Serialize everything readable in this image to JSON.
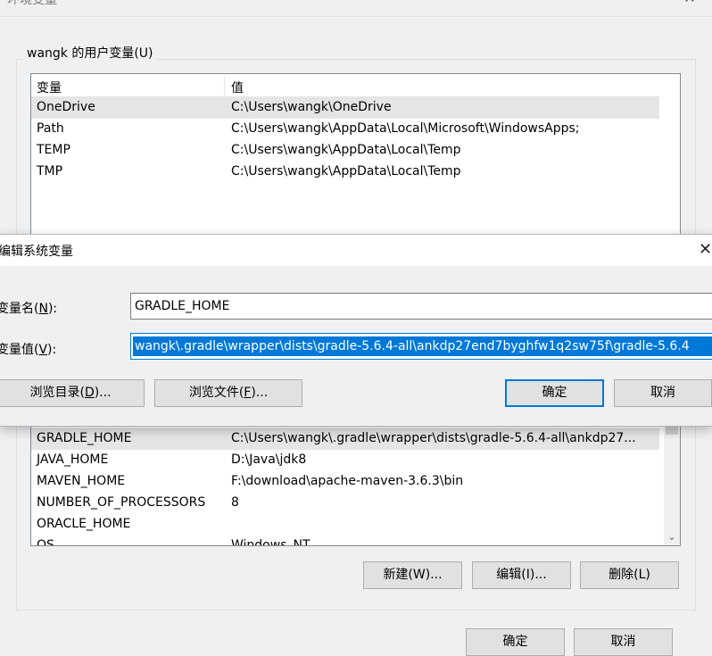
{
  "outer": {
    "title": "环境变量",
    "close_glyph": "✕",
    "user_group_label": "wangk 的用户变量(U)",
    "col_variable": "变量",
    "col_value": "值",
    "user_vars": [
      {
        "name": "OneDrive",
        "value": "C:\\Users\\wangk\\OneDrive"
      },
      {
        "name": "Path",
        "value": "C:\\Users\\wangk\\AppData\\Local\\Microsoft\\WindowsApps;"
      },
      {
        "name": "TEMP",
        "value": "C:\\Users\\wangk\\AppData\\Local\\Temp"
      },
      {
        "name": "TMP",
        "value": "C:\\Users\\wangk\\AppData\\Local\\Temp"
      }
    ],
    "sys_vars": [
      {
        "name": "GRADLE_HOME",
        "value": "C:\\Users\\wangk\\.gradle\\wrapper\\dists\\gradle-5.6.4-all\\ankdp27..."
      },
      {
        "name": "JAVA_HOME",
        "value": "D:\\Java\\jdk8"
      },
      {
        "name": "MAVEN_HOME",
        "value": "F:\\download\\apache-maven-3.6.3\\bin"
      },
      {
        "name": "NUMBER_OF_PROCESSORS",
        "value": "8"
      },
      {
        "name": "ORACLE_HOME",
        "value": ""
      },
      {
        "name": "OS",
        "value": "Windows_NT"
      }
    ],
    "buttons": {
      "new": "新建(W)...",
      "edit": "编辑(I)...",
      "delete": "删除(L)",
      "ok": "确定",
      "cancel": "取消"
    }
  },
  "dialog": {
    "title": "编辑系统变量",
    "close_glyph": "✕",
    "name_label": "变量名(",
    "name_key": "N",
    "name_label_end": "):",
    "value_label": "变量值(",
    "value_key": "V",
    "value_label_end": "):",
    "name_value": "GRADLE_HOME",
    "value_value": "wangk\\.gradle\\wrapper\\dists\\gradle-5.6.4-all\\ankdp27end7byghfw1q2sw75f\\gradle-5.6.4",
    "browse_dir_label": "浏览目录(",
    "browse_dir_key": "D",
    "browse_dir_end": ")...",
    "browse_file_label": "浏览文件(",
    "browse_file_key": "F",
    "browse_file_end": ")...",
    "ok": "确定",
    "cancel": "取消"
  },
  "icons": {
    "scroll_down": "⌄"
  }
}
